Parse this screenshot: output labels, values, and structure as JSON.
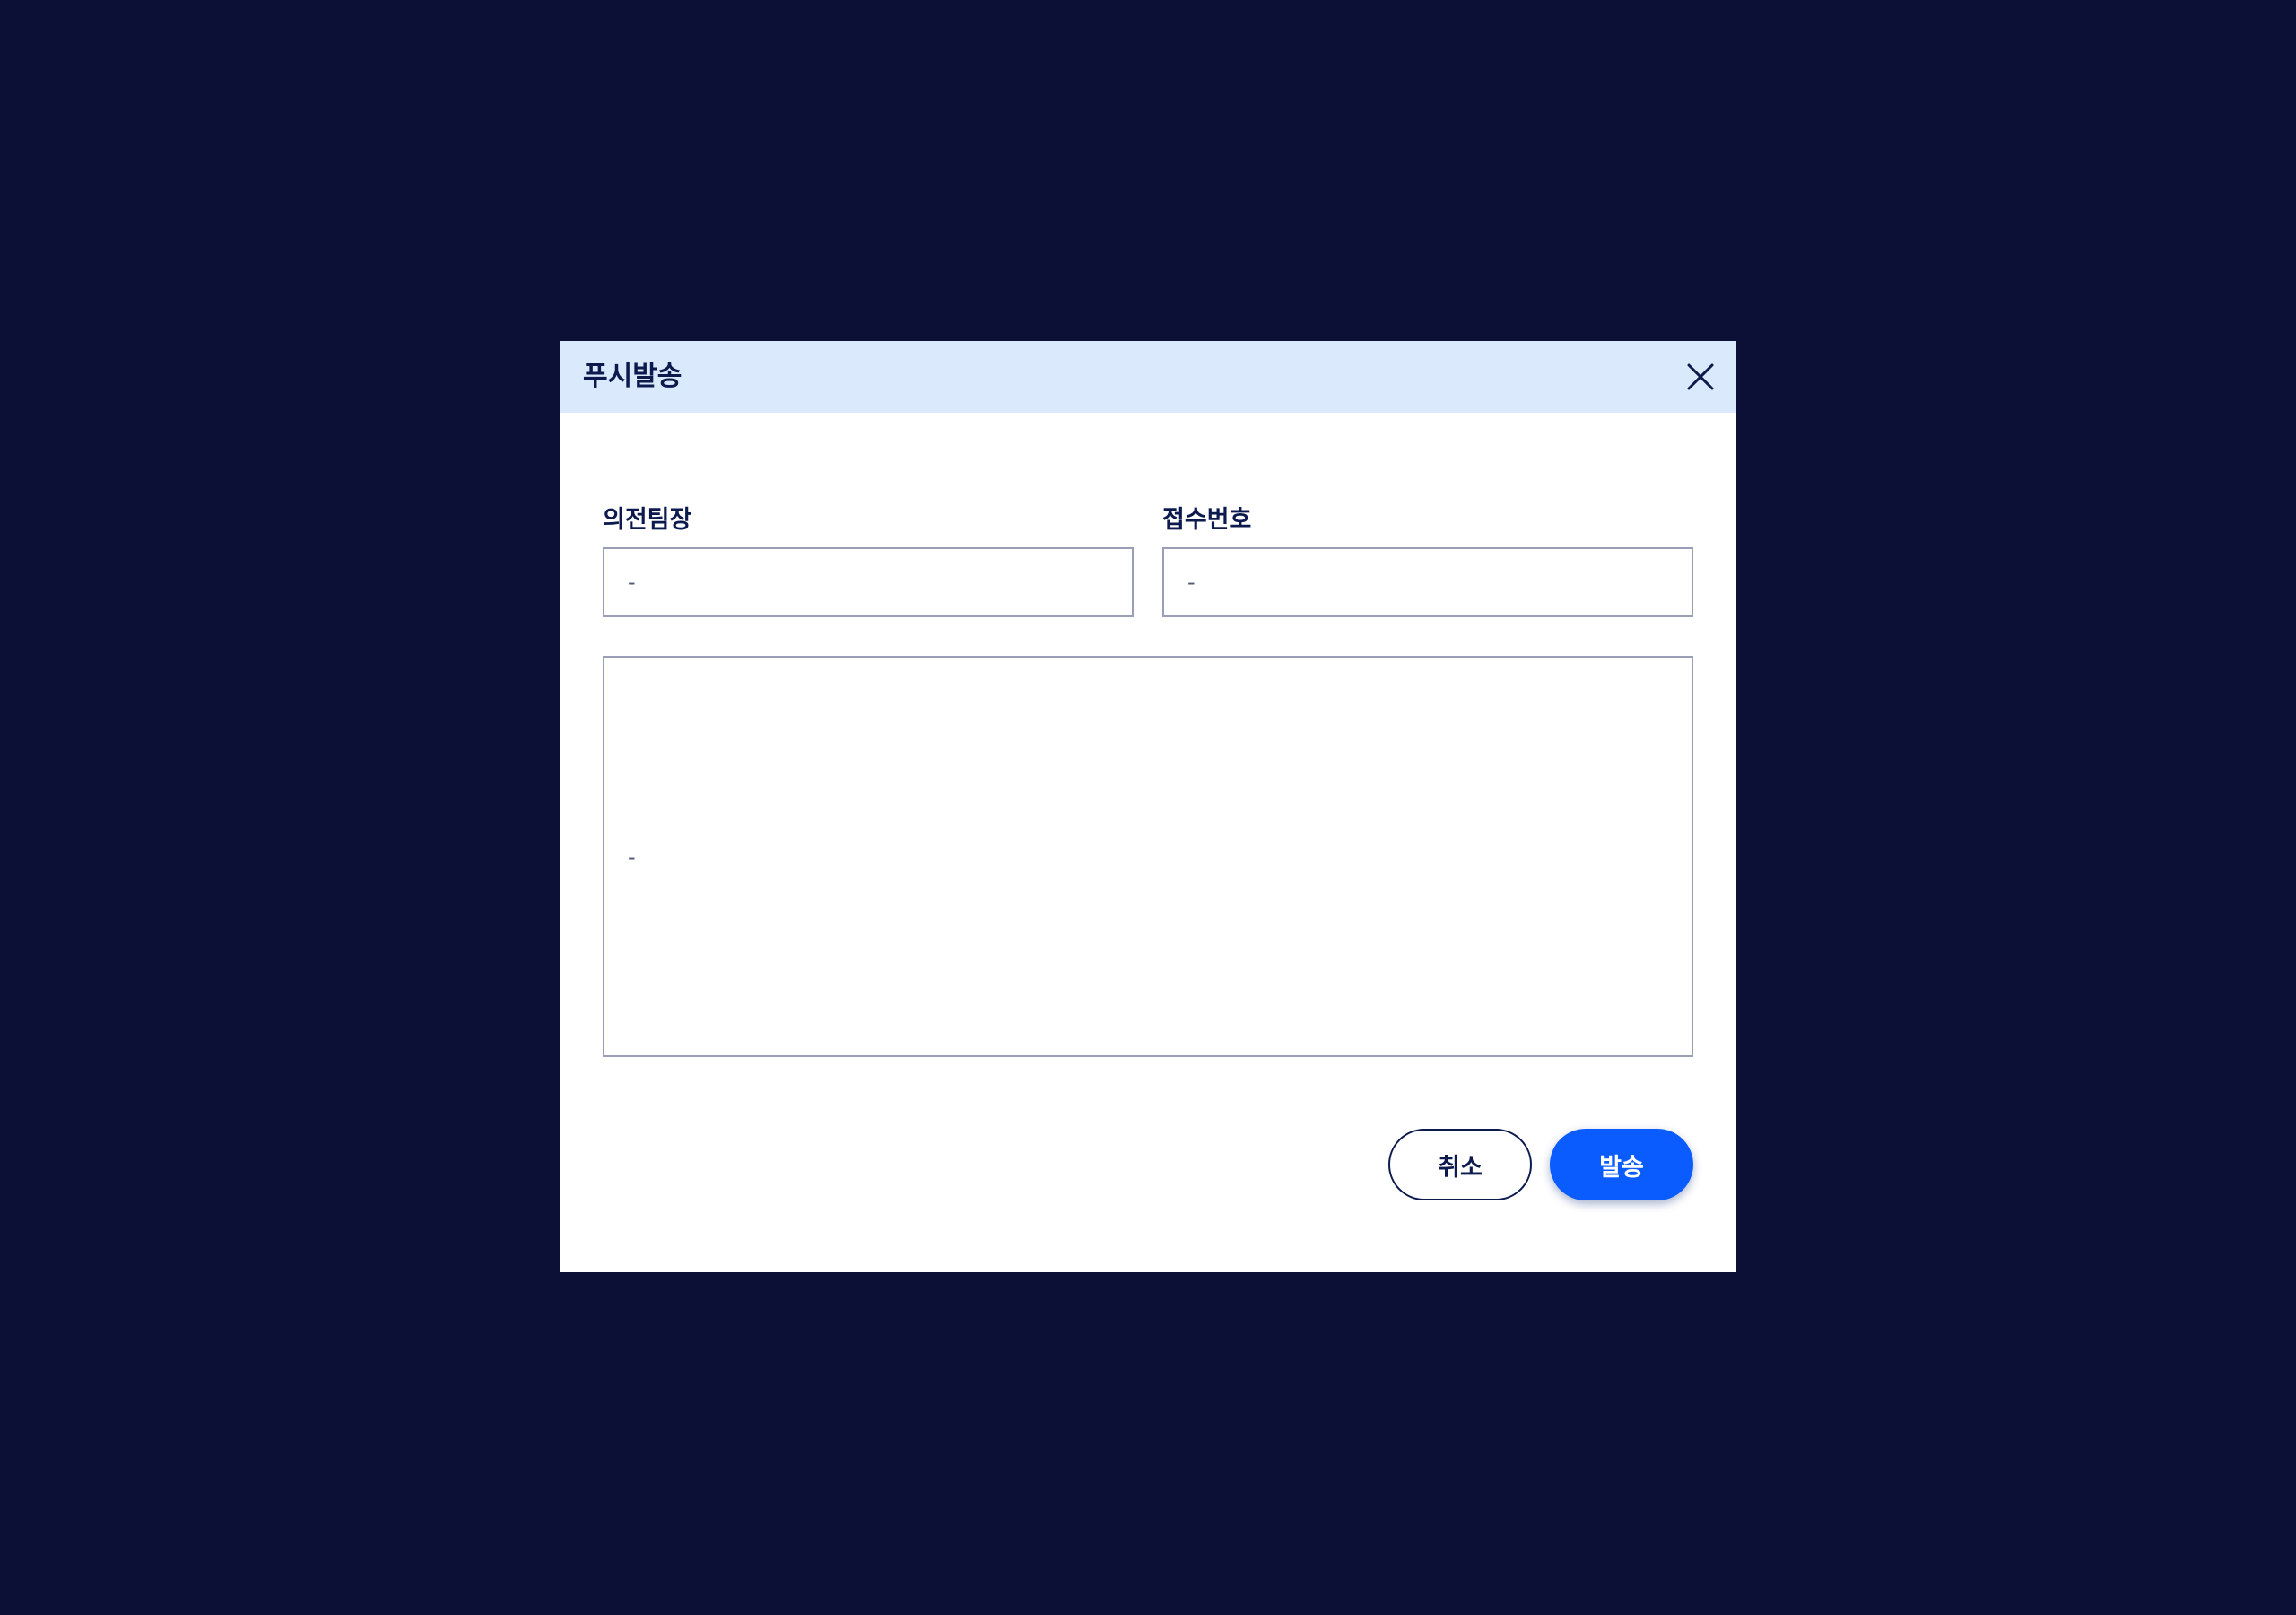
{
  "modal": {
    "title": "푸시발송",
    "close_icon": "close-icon"
  },
  "fields": {
    "team_leader": {
      "label": "의전팀장",
      "value": "-"
    },
    "receipt_number": {
      "label": "접수번호",
      "value": "-"
    },
    "message": {
      "value": "-"
    }
  },
  "buttons": {
    "cancel_label": "취소",
    "send_label": "발송"
  },
  "colors": {
    "backdrop": "#0c0f36",
    "header_bg": "#dbe9fd",
    "primary": "#0a5cff",
    "text_dark": "#0c1a4d"
  }
}
